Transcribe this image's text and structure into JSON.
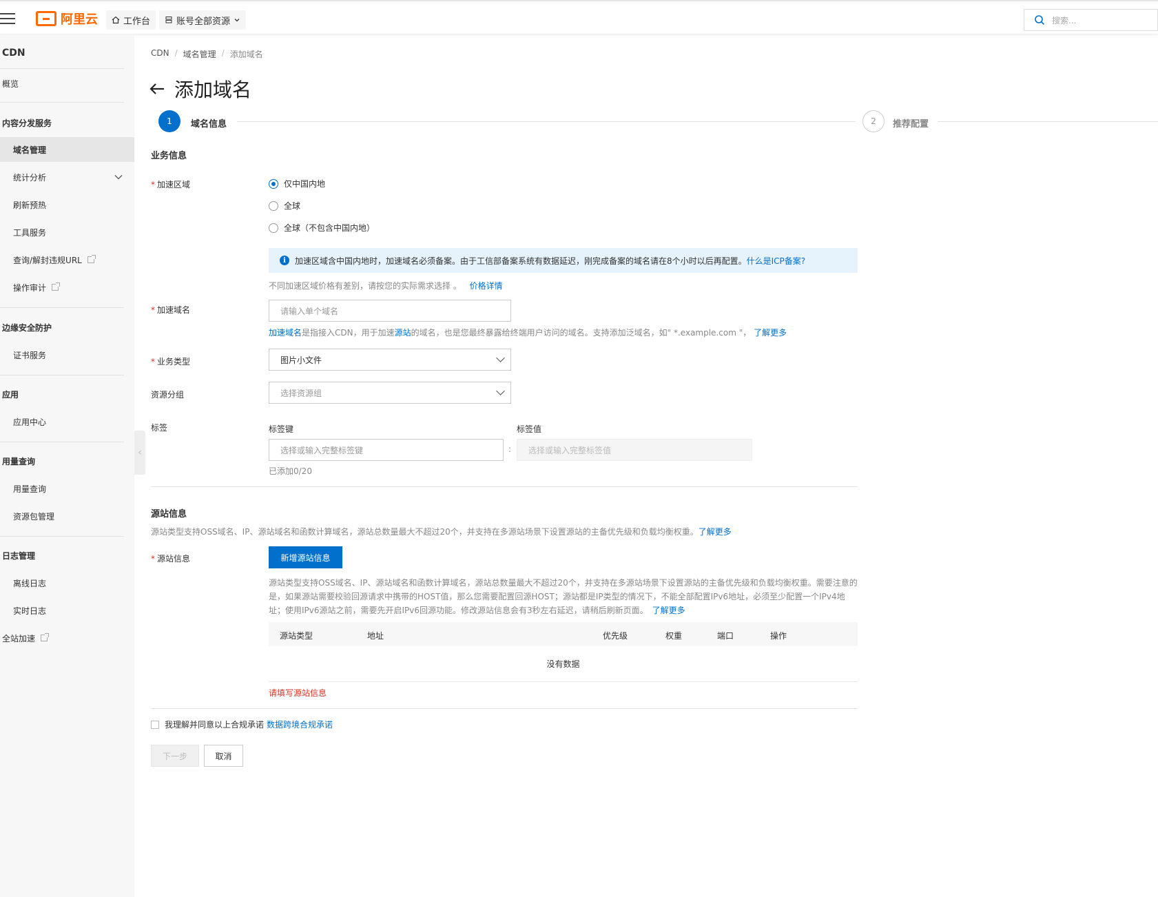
{
  "header": {
    "logo_text": "阿里云",
    "workbench_label": "工作台",
    "resources_label": "账号全部资源",
    "search_placeholder": "搜索..."
  },
  "sidebar": {
    "title": "CDN",
    "items": [
      {
        "label": "概览",
        "type": "item"
      },
      {
        "label": "内容分发服务",
        "type": "group"
      },
      {
        "label": "域名管理",
        "type": "subitem",
        "active": true
      },
      {
        "label": "统计分析",
        "type": "subitem"
      },
      {
        "label": "刷新预热",
        "type": "subitem"
      },
      {
        "label": "工具服务",
        "type": "subitem"
      },
      {
        "label": "查询/解封违规URL",
        "type": "subitem"
      },
      {
        "label": "操作审计",
        "type": "subitem"
      },
      {
        "label": "边缘安全防护",
        "type": "group"
      },
      {
        "label": "证书服务",
        "type": "subitem"
      },
      {
        "label": "应用",
        "type": "group"
      },
      {
        "label": "应用中心",
        "type": "subitem"
      },
      {
        "label": "用量查询",
        "type": "group"
      },
      {
        "label": "用量查询",
        "type": "subitem"
      },
      {
        "label": "资源包管理",
        "type": "subitem"
      },
      {
        "label": "日志管理",
        "type": "group"
      },
      {
        "label": "离线日志",
        "type": "subitem"
      },
      {
        "label": "实时日志",
        "type": "subitem"
      },
      {
        "label": "全站加速",
        "type": "item"
      }
    ]
  },
  "breadcrumb": [
    "CDN",
    "域名管理",
    "添加域名"
  ],
  "page_title": "添加域名",
  "steps": [
    {
      "number": "1",
      "label": "域名信息",
      "active": true
    },
    {
      "number": "2",
      "label": "推荐配置",
      "active": false
    }
  ],
  "business_section": {
    "title": "业务信息",
    "region": {
      "label": "加速区域",
      "options": [
        "仅中国内地",
        "全球",
        "全球（不包含中国内地）"
      ],
      "selected_index": 0,
      "notice_text": "加速区域含中国内地时，加速域名必须备案。由于工信部备案系统有数据延迟，刚完成备案的域名请在8个小时以后再配置。",
      "notice_link": "什么是ICP备案?",
      "price_hint": "不同加速区域价格有差别，请按您的实际需求选择 。",
      "price_link": "价格详情"
    },
    "domain": {
      "label": "加速域名",
      "placeholder": "请输入单个域名",
      "help_link1": "加速域名",
      "help_text1": "是指接入CDN，用于加速",
      "help_link2": "源站",
      "help_text2": "的域名，也是您最终暴露给终端用户访问的域名。支持添加泛域名，如\" *.example.com \"，",
      "help_link3": "了解更多"
    },
    "business_type": {
      "label": "业务类型",
      "value": "图片小文件"
    },
    "resource_group": {
      "label": "资源分组",
      "placeholder": "选择资源组"
    },
    "tags": {
      "label": "标签",
      "key_label": "标签键",
      "value_label": "标签值",
      "key_placeholder": "选择或输入完整标签键",
      "value_placeholder": "选择或输入完整标签值",
      "separator": ":",
      "count_text": "已添加0/20"
    }
  },
  "origin_section": {
    "title": "源站信息",
    "desc": "源站类型支持OSS域名、IP、源站域名和函数计算域名，源站总数量最大不超过20个，并支持在多源站场景下设置源站的主备优先级和负载均衡权重。",
    "desc_link": "了解更多",
    "field_label": "源站信息",
    "add_button": "新增源站信息",
    "detail_line1": "源站类型支持OSS域名、IP、源站域名和函数计算域名，源站总数量最大不超过20个，并支持在多源站场景下设置源站的主备优先级和负载均衡权重。需要注意的",
    "detail_line2": "是，如果源站需要校验回源请求中携带的HOST值，那么您需要配置回源HOST；源站都是IP类型的情况下，不能全部配置IPv6地址，必须至少配置一个IPv4地",
    "detail_line3": "址；使用IPv6源站之前，需要先开启IPv6回源功能。修改源站信息会有3秒左右延迟，请稍后刷新页面。",
    "detail_link": "了解更多",
    "table_headers": [
      "源站类型",
      "地址",
      "优先级",
      "权重",
      "端口",
      "操作"
    ],
    "empty_text": "没有数据",
    "error_text": "请填写源站信息"
  },
  "agreement": {
    "text": "我理解并同意以上合规承诺",
    "link": "数据跨境合规承诺"
  },
  "buttons": {
    "next": "下一步",
    "cancel": "取消"
  },
  "colors": {
    "primary": "#0070cc",
    "brand": "#ff6a00",
    "error": "#d93026"
  }
}
